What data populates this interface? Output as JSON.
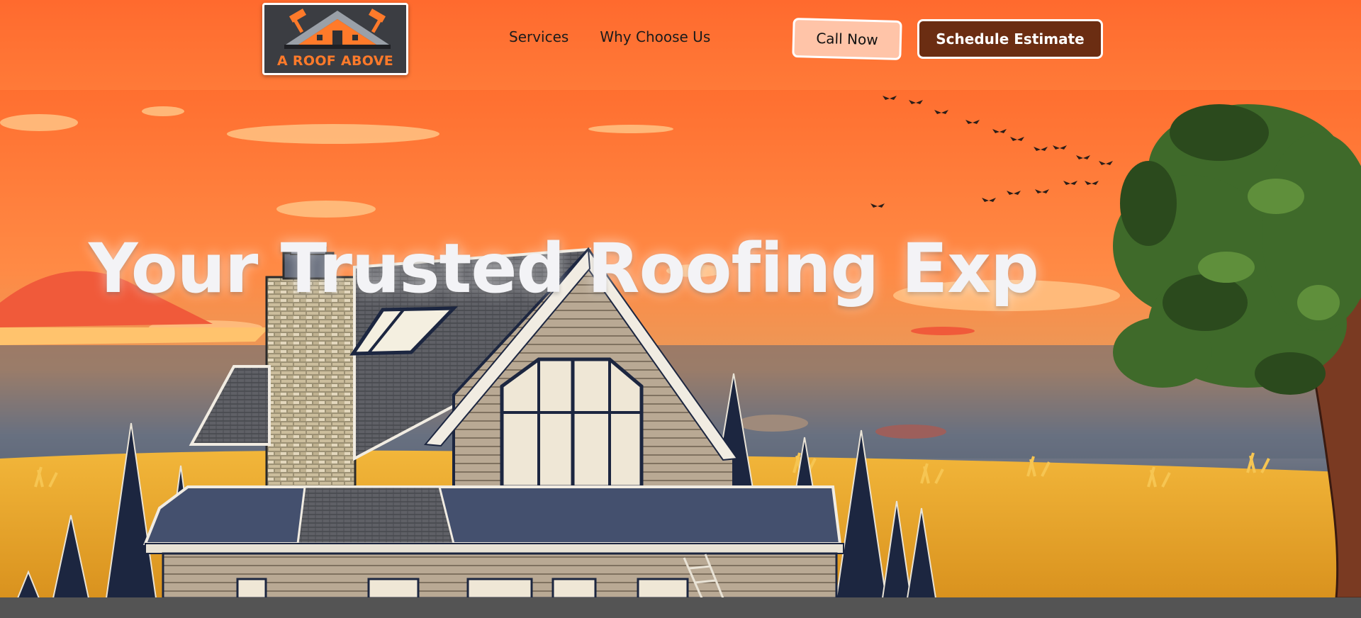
{
  "brand": {
    "logo_text": "A ROOF ABOVE"
  },
  "nav": {
    "items": [
      {
        "label": "Services"
      },
      {
        "label": "Why Choose Us"
      }
    ]
  },
  "header_buttons": {
    "call_label": "Call Now",
    "estimate_label": "Schedule Estimate"
  },
  "hero": {
    "headline": "Your Trusted Roofing Exp"
  },
  "colors": {
    "sky_orange": "#ff6f30",
    "estimate_button": "#6b2d12",
    "call_button": "#ffc4a8",
    "footer_bar": "#545454"
  },
  "icons": [
    "roof-logo-icon",
    "hammer-icon",
    "house-illustration",
    "tree-illustration",
    "birds-illustration"
  ]
}
